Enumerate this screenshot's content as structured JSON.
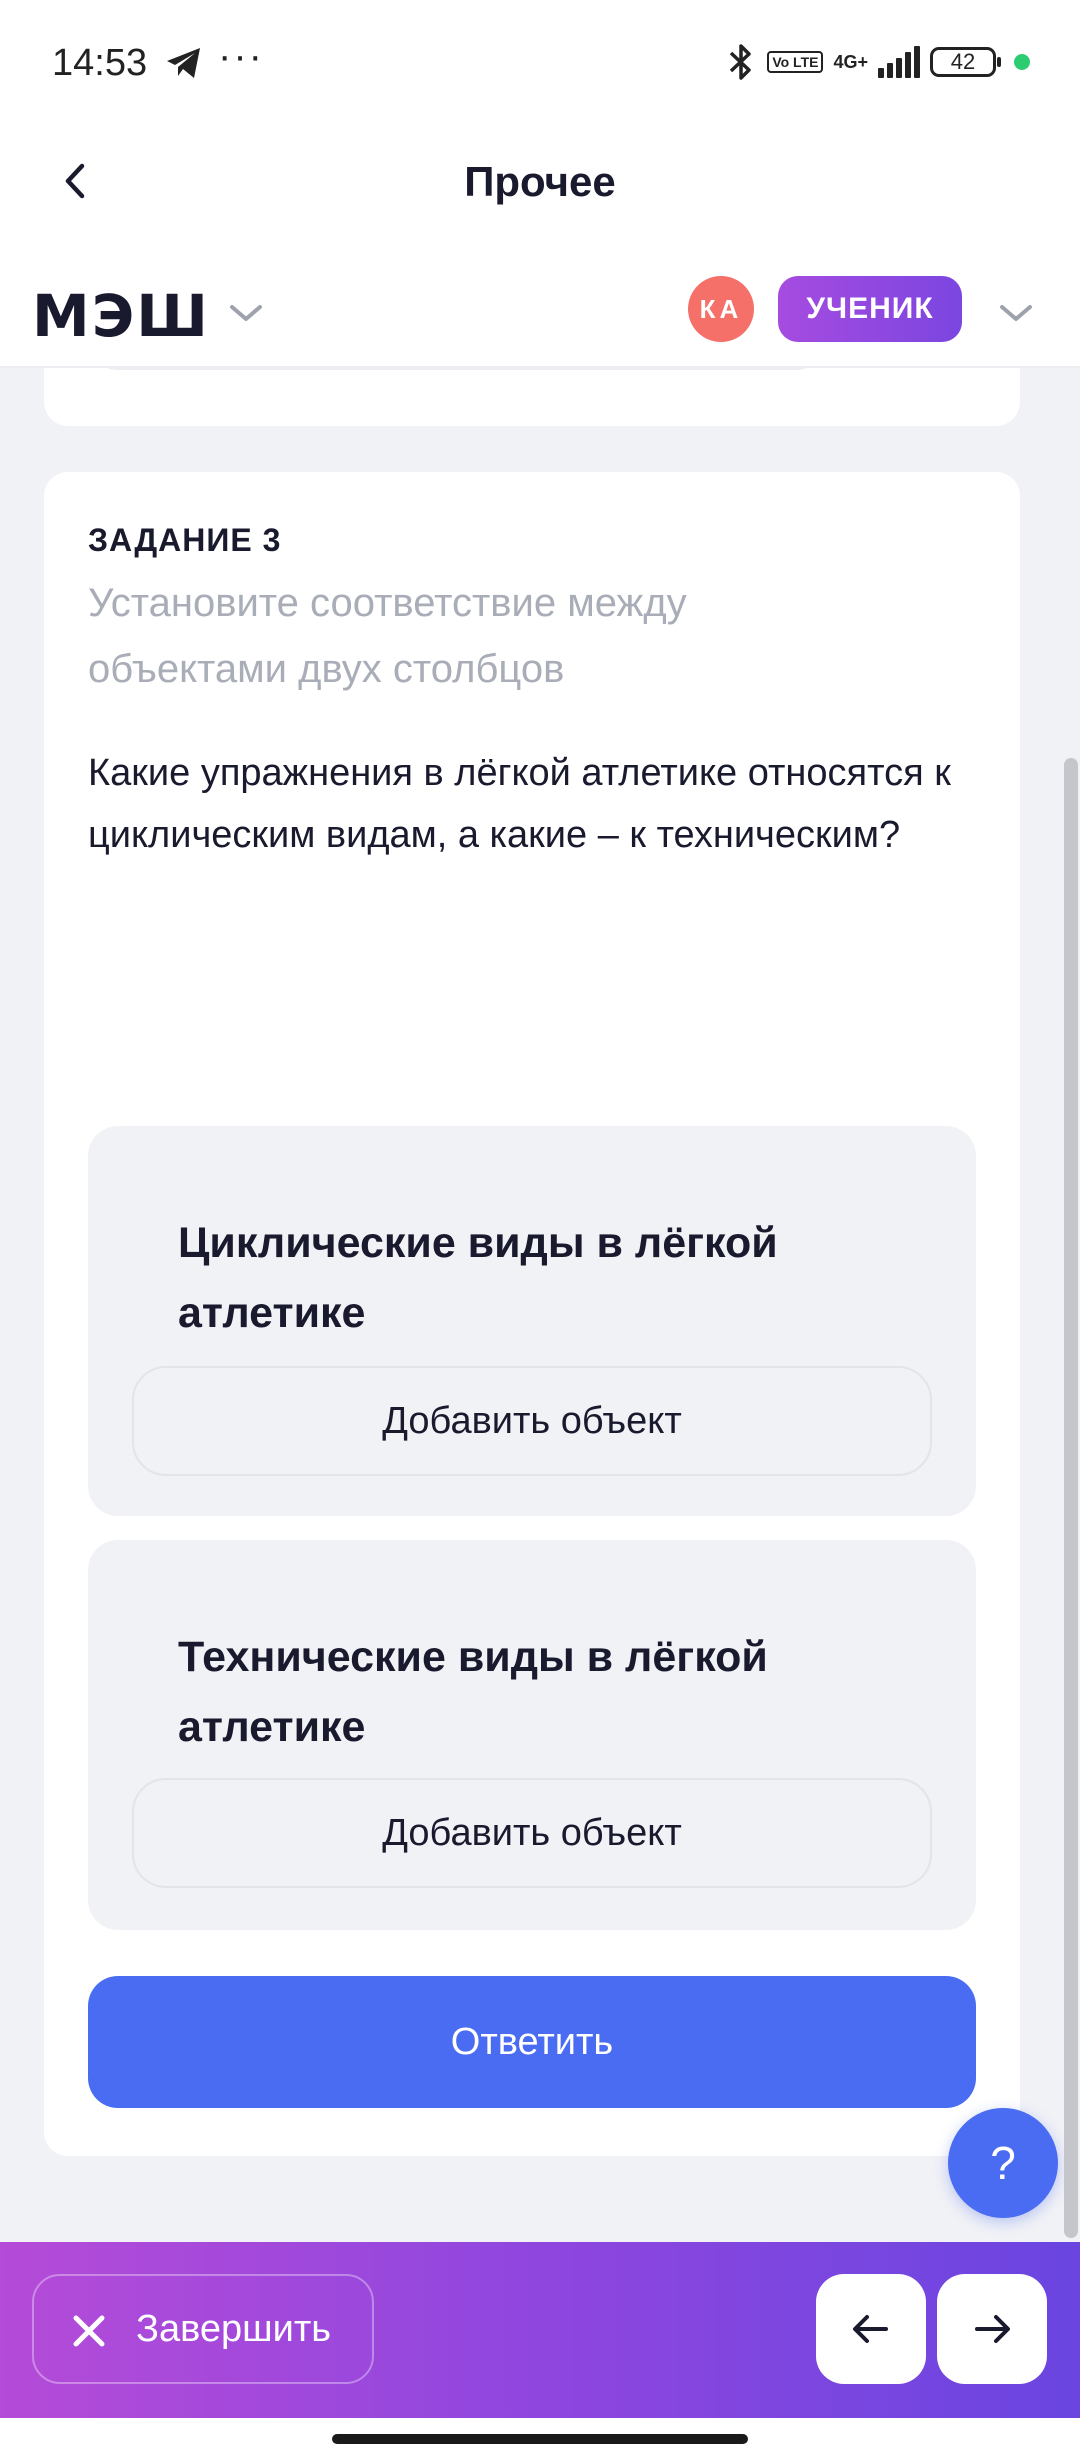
{
  "status_bar": {
    "time": "14:53",
    "dots": "···",
    "volte": "Vo LTE",
    "network": "4G+",
    "battery": "42"
  },
  "nav": {
    "title": "Прочее"
  },
  "app_header": {
    "logo": "МЭШ",
    "avatar_initials": "КА",
    "role": "УЧЕНИК",
    "colors": {
      "avatar": "#f47069",
      "role_badge": "#8b46df"
    }
  },
  "task": {
    "label": "ЗАДАНИЕ 3",
    "hint": "Установите соответствие между объектами двух столбцов",
    "question": "Какие упражнения в лёгкой атлетике относятся к циклическим видам, а какие – к техническим?",
    "groups": [
      {
        "title": "Циклические виды в лёгкой атлетике",
        "add_label": "Добавить объект"
      },
      {
        "title": "Технические виды в лёгкой атлетике",
        "add_label": "Добавить объект"
      }
    ],
    "answer_label": "Ответить"
  },
  "help_button": {
    "label": "?"
  },
  "bottom_bar": {
    "finish_label": "Завершить",
    "prev_icon": "arrow-left-icon",
    "next_icon": "arrow-right-icon"
  },
  "colors": {
    "accent": "#4a6cf2",
    "background": "#f1f2f6",
    "bottom_bar_start": "#b54bd8",
    "bottom_bar_end": "#6a45e0"
  }
}
